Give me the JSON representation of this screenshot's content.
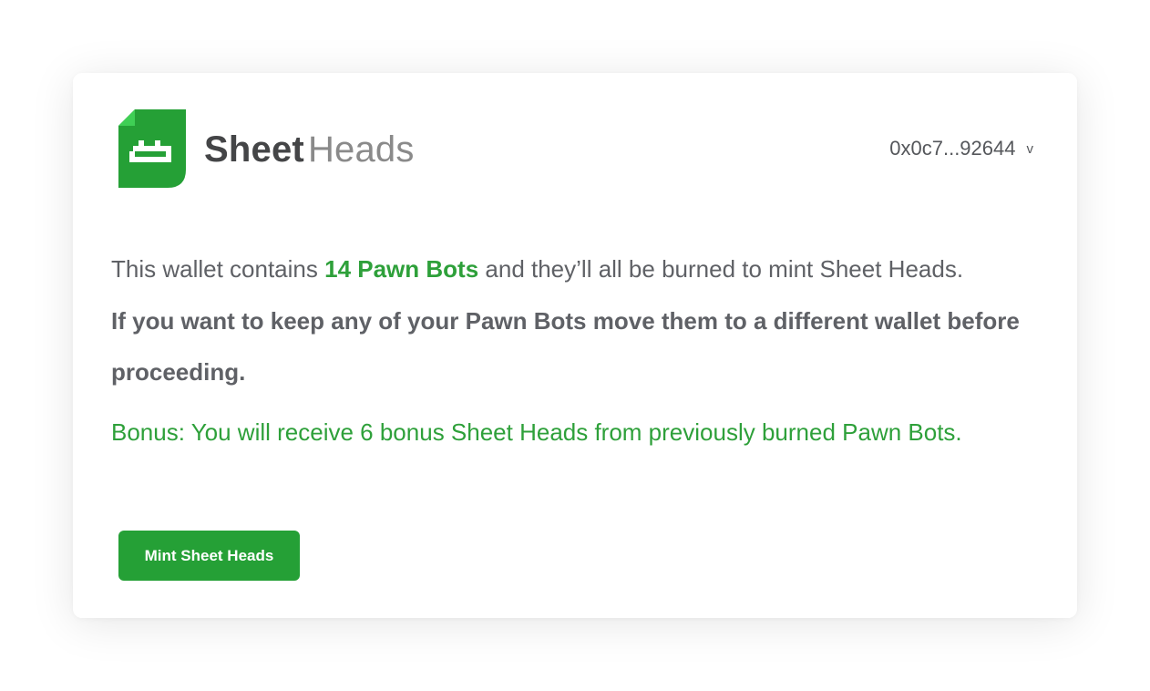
{
  "brand": {
    "part1": "Sheet",
    "part2": "Heads",
    "logo_icon": "sheet-bot-logo"
  },
  "wallet": {
    "address": "0x0c7...92644",
    "chevron": "v"
  },
  "message": {
    "intro_before": "This wallet contains ",
    "highlight": "14 Pawn Bots",
    "intro_after": " and they’ll all be burned to mint Sheet Heads.",
    "warning": "If you want to keep any of your Pawn Bots move them to a different wallet before proceeding.",
    "bonus": "Bonus: You will receive 6 bonus Sheet Heads from previously burned Pawn Bots."
  },
  "actions": {
    "mint_label": "Mint Sheet Heads"
  },
  "colors": {
    "brand_green": "#25a036",
    "highlight_green": "#2ea03a",
    "text_gray": "#5f6166"
  }
}
